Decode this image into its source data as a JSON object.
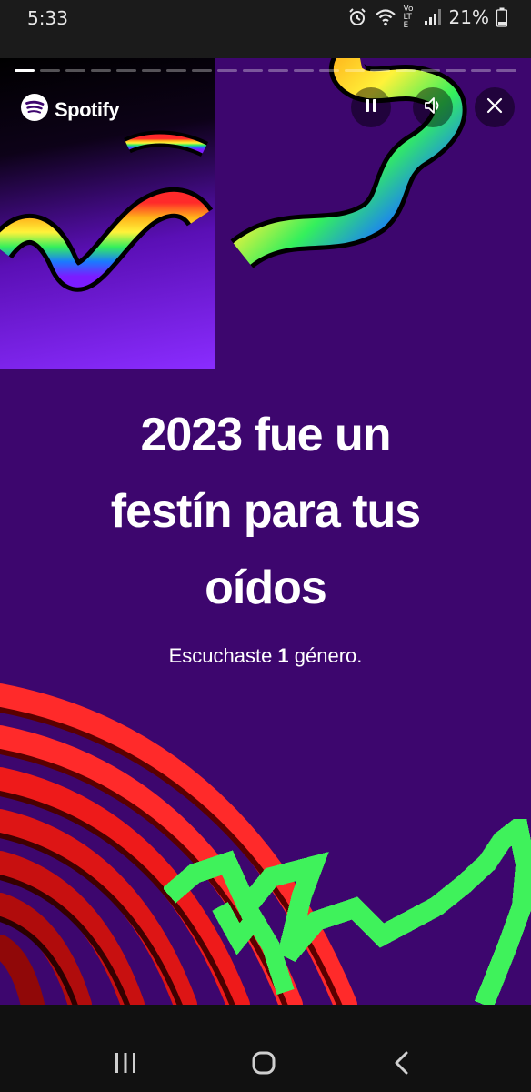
{
  "status_bar": {
    "time": "5:33",
    "volte_label": "Vo LTE",
    "battery_percent": "21%",
    "icons": [
      "alarm-icon",
      "wifi-icon",
      "volte-icon",
      "signal-icon",
      "battery-icon"
    ]
  },
  "story": {
    "brand": "Spotify",
    "progress": {
      "total_segments": 20,
      "current_segment": 1
    },
    "controls": [
      "pause-icon",
      "volume-icon",
      "close-icon"
    ],
    "headline_lines": [
      "2023 fue un",
      "festín para tus",
      "oídos"
    ],
    "subtitle": {
      "before": "Escuchaste ",
      "count": "1",
      "after": " género."
    },
    "colors": {
      "background": "#3d066e",
      "accent_green": "#3ff25b",
      "accent_red": "#e8151f"
    }
  },
  "nav_bar": {
    "icons": [
      "recents-icon",
      "home-icon",
      "back-icon"
    ]
  }
}
